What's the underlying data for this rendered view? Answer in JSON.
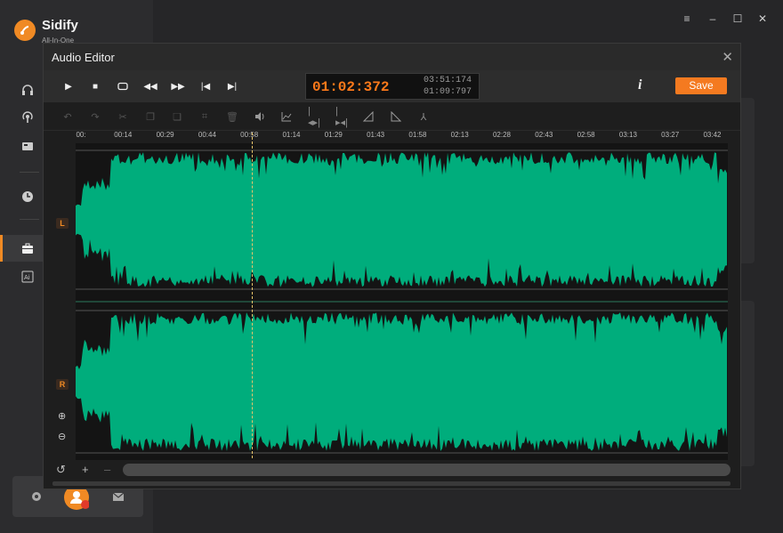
{
  "app": {
    "brand": "Sidify",
    "brand_sub": "All-In-One"
  },
  "dialog": {
    "title": "Audio Editor",
    "time_current": "01:02:372",
    "time_total": "03:51:174",
    "time_selection": "01:09:797",
    "info_label": "i",
    "save_label": "Save"
  },
  "ruler": {
    "ticks": [
      "00:",
      "00:14",
      "00:29",
      "00:44",
      "00:58",
      "01:14",
      "01:29",
      "01:43",
      "01:58",
      "02:13",
      "02:28",
      "02:43",
      "02:58",
      "03:13",
      "03:27",
      "03:42"
    ]
  },
  "channels": {
    "left": "L",
    "right": "R"
  },
  "colors": {
    "accent": "#f47a20",
    "waveform": "#00ad7c",
    "playhead": "#e8c56a"
  },
  "playback": {
    "position": "01:02:372"
  }
}
